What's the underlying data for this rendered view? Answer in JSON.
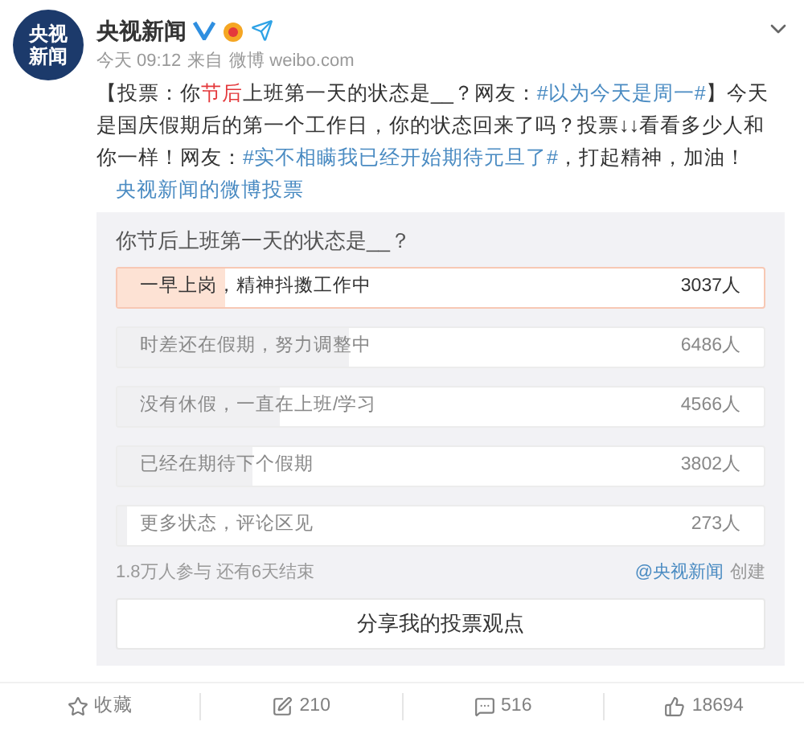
{
  "post": {
    "avatar_text": [
      "央视",
      "新闻"
    ],
    "author": "央视新闻",
    "meta": [
      "今天 09:12",
      "来自",
      "微博 weibo.com"
    ],
    "body": [
      {
        "kind": "text",
        "text": "【投票：你"
      },
      {
        "kind": "highlight",
        "text": "节后"
      },
      {
        "kind": "text",
        "text": "上班第一天的状态是__？网友："
      },
      {
        "kind": "link",
        "text": "#以为今天是周一#"
      },
      {
        "kind": "text",
        "text": "】今天是国庆假期后的第一个工作日，你的状态回来了吗？投票↓↓看看多少人和你一样！网友："
      },
      {
        "kind": "link",
        "text": "#实不相瞒我已经开始期待元旦了#"
      },
      {
        "kind": "text",
        "text": "，打起精神，加油！ "
      },
      {
        "kind": "source",
        "text": "央视新闻的微博投票"
      }
    ]
  },
  "poll": {
    "question": "你节后上班第一天的状态是__？",
    "options": [
      {
        "label": "一早上岗，精神抖擞工作中",
        "count": "3037人",
        "level": 0.167,
        "selected": true
      },
      {
        "label": "时差还在假期，努力调整中",
        "count": "6486人",
        "level": 0.357,
        "selected": false
      },
      {
        "label": "没有休假，一直在上班/学习",
        "count": "4566人",
        "level": 0.251,
        "selected": false
      },
      {
        "label": "已经在期待下个假期",
        "count": "3802人",
        "level": 0.209,
        "selected": false
      },
      {
        "label": "更多状态，评论区见",
        "count": "273人",
        "level": 0.015,
        "selected": false
      }
    ],
    "summary": "1.8万人参与 还有6天结束",
    "creator": "@央视新闻",
    "created": "创建",
    "share_button": "分享我的投票观点"
  },
  "actions": [
    {
      "kind": "favorite",
      "label": "收藏"
    },
    {
      "kind": "repost",
      "label": "210"
    },
    {
      "kind": "comment",
      "label": "516"
    },
    {
      "kind": "like",
      "label": "18694"
    }
  ]
}
